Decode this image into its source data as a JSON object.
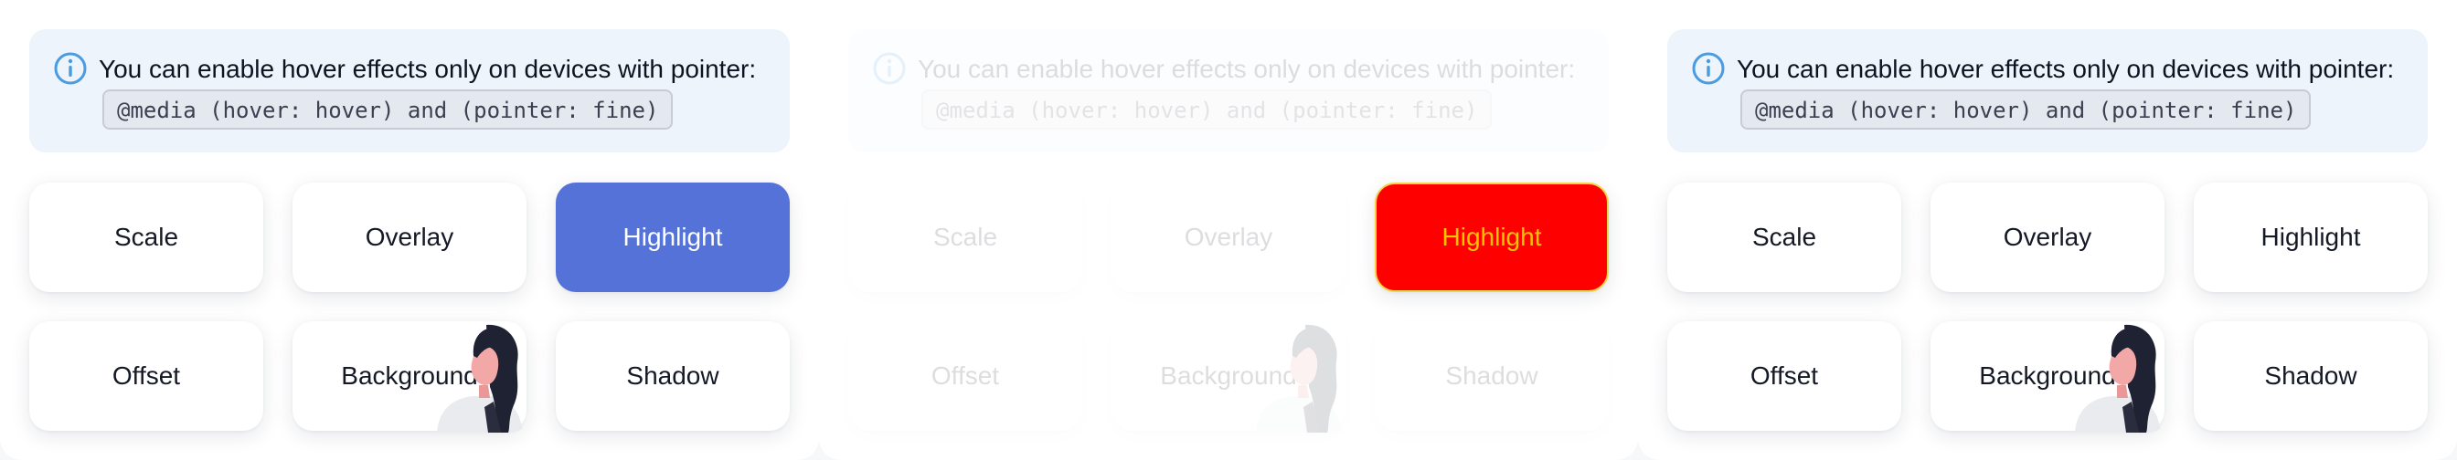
{
  "info": {
    "text": "You can enable hover effects only on devices with pointer:",
    "code": "@media (hover: hover) and (pointer: fine)"
  },
  "buttons": {
    "scale": "Scale",
    "overlay": "Overlay",
    "highlight": "Highlight",
    "offset": "Offset",
    "background": "Background",
    "shadow": "Shadow"
  },
  "colors": {
    "info_bg": "#edf4fc",
    "info_icon": "#4a9be0",
    "highlight_active": "#5472d8",
    "highlight_alert_bg": "#ff0000",
    "highlight_alert_text": "#ffc400"
  },
  "icons": {
    "info": "info-circle-icon",
    "avatar": "woman-avatar-illustration"
  }
}
